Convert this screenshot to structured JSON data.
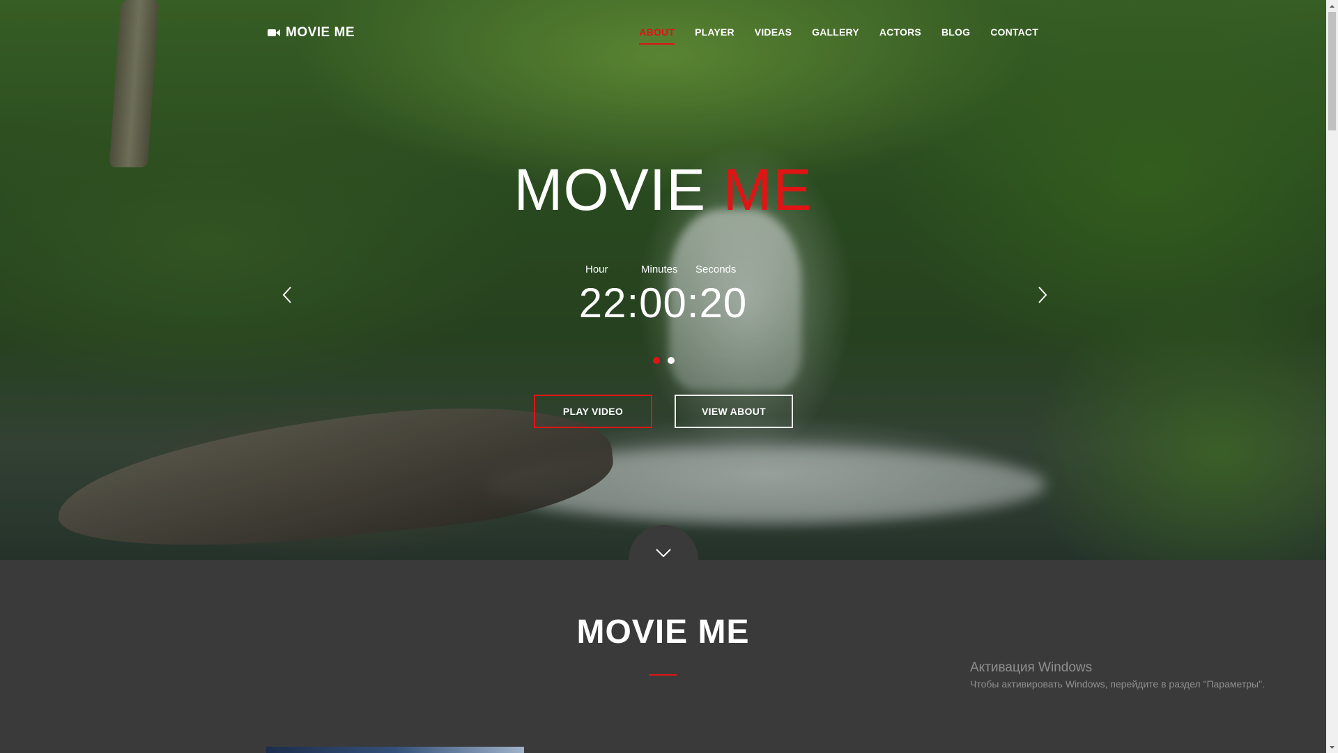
{
  "nav": {
    "logo_text": "MOVIE ME",
    "logo_icon": "video-camera-icon",
    "items": [
      {
        "label": "ABOUT",
        "active": true
      },
      {
        "label": "PLAYER",
        "active": false
      },
      {
        "label": "VIDEAS",
        "active": false
      },
      {
        "label": "GALLERY",
        "active": false
      },
      {
        "label": "ACTORS",
        "active": false
      },
      {
        "label": "BLOG",
        "active": false
      },
      {
        "label": "CONTACT",
        "active": false
      }
    ]
  },
  "hero": {
    "title_main": "MOVIE",
    "title_accent": "ME",
    "timer": {
      "hour_label": "Hour",
      "minutes_label": "Minutes",
      "seconds_label": "Seconds",
      "value": "22:00:20"
    },
    "slides_total": 2,
    "active_slide": 1,
    "buttons": {
      "play_label": "PLAY VIDEO",
      "about_label": "VIEW ABOUT"
    }
  },
  "section": {
    "title": "MOVIE ME"
  },
  "windows_activation": {
    "title": "Активация Windows",
    "message": "Чтобы активировать Windows, перейдите в раздел \"Параметры\"."
  },
  "colors": {
    "accent": "#e01414",
    "section_bg": "#3a3a3a",
    "text": "#ffffff"
  }
}
